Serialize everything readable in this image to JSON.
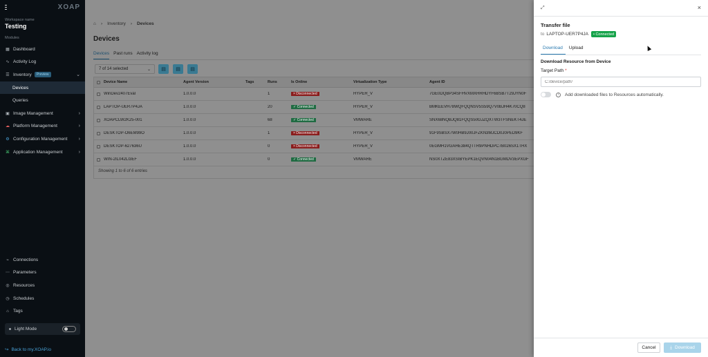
{
  "sidebar": {
    "logo": "XOAP",
    "workspace_label": "Workspace name",
    "workspace_name": "Testing",
    "modules_label": "Modules",
    "items": [
      {
        "label": "Dashboard",
        "icon": "dashboard-icon"
      },
      {
        "label": "Activity Log",
        "icon": "activity-icon"
      },
      {
        "label": "Inventory",
        "icon": "inventory-icon",
        "badge": "Preview"
      },
      {
        "label": "Devices",
        "active": true
      },
      {
        "label": "Queries"
      },
      {
        "label": "Image Management",
        "icon": "image-icon"
      },
      {
        "label": "Platform Management",
        "icon": "platform-icon"
      },
      {
        "label": "Configuration Management",
        "icon": "config-icon"
      },
      {
        "label": "Application Management",
        "icon": "app-icon"
      }
    ],
    "bottom_items": [
      {
        "label": "Connections"
      },
      {
        "label": "Parameters"
      },
      {
        "label": "Resources"
      },
      {
        "label": "Schedules"
      },
      {
        "label": "Tags"
      }
    ],
    "light_mode": "Light Mode",
    "back_link": "Back to my.XOAP.io"
  },
  "main": {
    "breadcrumb": [
      "Inventory",
      "Devices"
    ],
    "title": "Devices",
    "tabs": [
      "Devices",
      "Past runs",
      "Activity log"
    ],
    "selection": "7 of 14 selected",
    "columns": [
      "Device Name",
      "Agent Version",
      "Tags",
      "Runs",
      "Is Online",
      "Virtualization Type",
      "Agent ID"
    ],
    "rows": [
      {
        "name": "WinDev2407Eval",
        "version": "1.0.0.0",
        "tags": "",
        "runs": "1",
        "status": "Disconnected",
        "virt": "HYPER_V",
        "agent_id": "7GE0DQBP34SFHVXMXHRHDYF6BSB7T29JYN0F"
      },
      {
        "name": "LAPTOP-UER7P4JA",
        "version": "1.0.0.0",
        "tags": "",
        "runs": "20",
        "status": "Connected",
        "virt": "HYPER_V",
        "agent_id": "BMKEEVH78WQFQQNSV5S59Q7V0BJH4K70CQ8"
      },
      {
        "name": "XOAPCLW2K25-001",
        "version": "1.0.0.0",
        "tags": "",
        "runs": "68",
        "status": "Connected",
        "virt": "VMWARE",
        "agent_id": "SNX68NQBJQ81FQQS50GJZQXTW3TFSNEKT4JE"
      },
      {
        "name": "DESKTOP-O6EM99O",
        "version": "1.0.0.0",
        "tags": "",
        "runs": "1",
        "status": "Disconnected",
        "virt": "HYPER_V",
        "agent_id": "91F9SBSX7W0HB9J00JFZKN3MJCD0J0PED9KF"
      },
      {
        "name": "DESKTOP-627636U",
        "version": "1.0.0.0",
        "tags": "",
        "runs": "0",
        "status": "Disconnected",
        "virt": "HYPER_V",
        "agent_id": "0EGMH1VGAHE384QTTR9PNHDPC7B026SX1THX"
      },
      {
        "name": "WIN-2IL042LI3EF",
        "version": "1.0.0.0",
        "tags": "",
        "runs": "0",
        "status": "Connected",
        "virt": "VMWARE",
        "agent_id": "NS0XTZE83XSIBYEPK1EQVN04N1BGMDV3EPXGF"
      }
    ],
    "footer": "Showing 1 to 6 of 6 entries"
  },
  "drawer": {
    "title": "Transfer file",
    "to_label": "to",
    "device": "LAPTOP-UER7P4JA",
    "device_status": "• Connected",
    "tabs": [
      "Download",
      "Upload"
    ],
    "section": "Download Resource from Device",
    "target_label": "Target Path",
    "required_mark": "*",
    "target_placeholder": "C:/device/path/",
    "toggle_label": "Add downloaded files to Resources automatically.",
    "cancel": "Cancel",
    "download": "Download"
  },
  "colors": {
    "sidebar_bg": "#0a0f14",
    "accent": "#2a7ab0",
    "connected": "#16a34a",
    "disconnected": "#8a1c1c"
  }
}
